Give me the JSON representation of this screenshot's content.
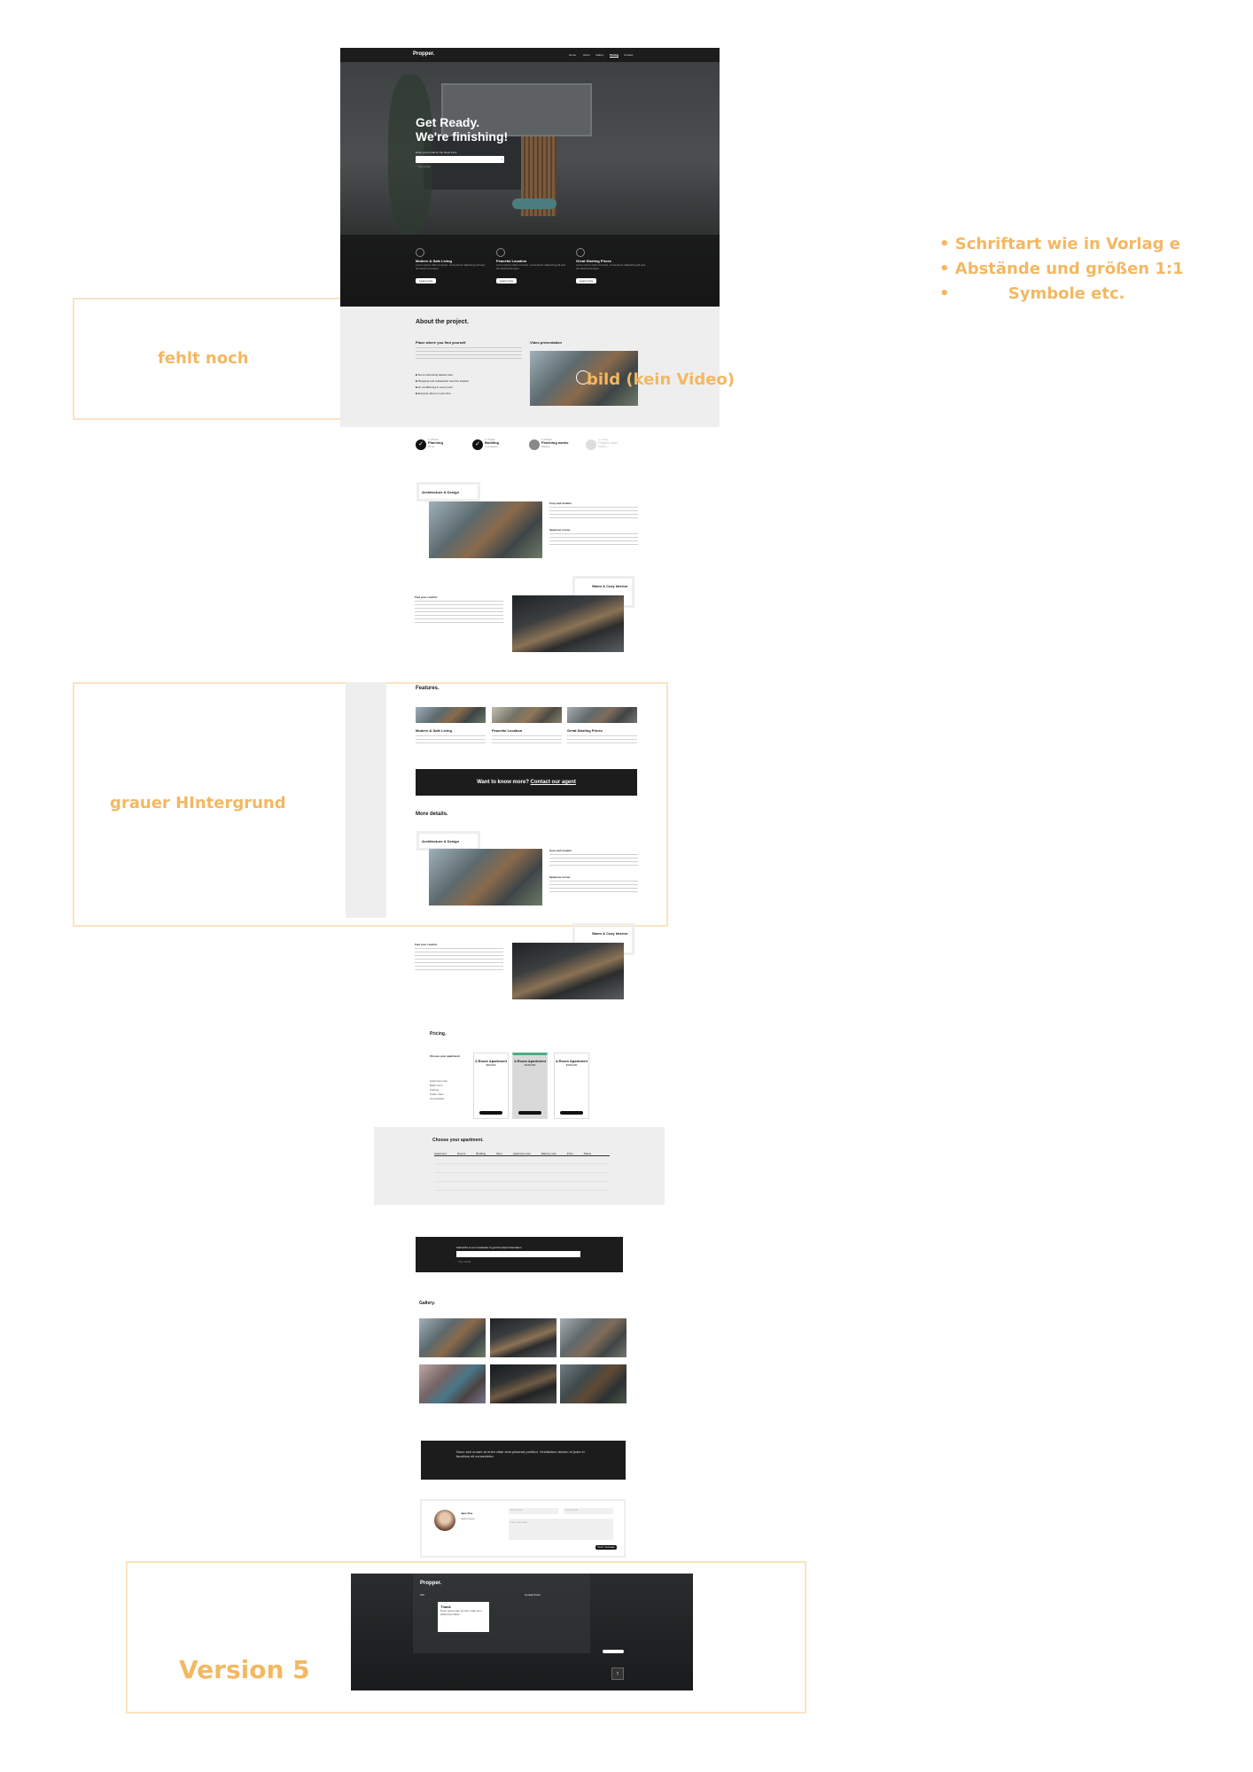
{
  "annotations": {
    "bullets": [
      "Schriftart wie in Vorlag e",
      "Abstände und größen 1:1",
      "Symbole etc."
    ],
    "missing": "fehlt noch",
    "image_note": "bild (kein Video)",
    "grey_bg": "grauer HIntergrund",
    "version": "Version 5"
  },
  "nav": {
    "logo": "Propper.",
    "items": [
      "Home",
      "About",
      "Gallery",
      "Pricing",
      "Contact"
    ],
    "active": "Pricing"
  },
  "hero": {
    "title_line1": "Get Ready.",
    "title_line2": "We're finishing!",
    "signup_label": "Enter your email for the latest infos",
    "email_placeholder": "Your email"
  },
  "hero_features": [
    {
      "title": "Modern & Safe Living",
      "text": "Lorem ipsum dolor sit amet, consectetur adipiscing elit sed do eiusmod tempor.",
      "button": "Learn more"
    },
    {
      "title": "Peaceful Location",
      "text": "Lorem ipsum dolor sit amet, consectetur adipiscing elit sed do eiusmod tempor.",
      "button": "Learn more"
    },
    {
      "title": "Great Starting Prices",
      "text": "Lorem ipsum dolor sit amet, consectetur adipiscing elit sed do eiusmod tempor.",
      "button": "Learn more"
    }
  ],
  "about": {
    "title": "About the project.",
    "subtitle": "Place where you find yourself",
    "video_label": "Video presentation",
    "checklist": [
      "Some interesting feature here",
      "Shopping and restaurants near the location",
      "Air conditioning in every room",
      "Enjoying nature in your time"
    ]
  },
  "progress": [
    {
      "step": "1. Phase",
      "name": "Planning",
      "status": "Done"
    },
    {
      "step": "2. Phase",
      "name": "Building",
      "status": "In progress"
    },
    {
      "step": "3. Phase",
      "name": "Finishing works",
      "status": "Waiting"
    },
    {
      "step": "4. Phase",
      "name": "Project done",
      "status": "Waiting"
    }
  ],
  "details_a": {
    "tag": "Architecture & Design",
    "h1": "Cozy and modern",
    "h2": "Spacious rooms"
  },
  "details_b": {
    "tag": "Warm & Cozy Interior",
    "h1": "Feel your comfort"
  },
  "features": {
    "title": "Features.",
    "items": [
      {
        "title": "Modern & Safe Living"
      },
      {
        "title": "Peaceful Location"
      },
      {
        "title": "Great Starting Prices"
      }
    ]
  },
  "cta": {
    "text": "Want to know more?",
    "link": "Contact our agent"
  },
  "more_details": {
    "title": "More details."
  },
  "pricing": {
    "title": "Pricing.",
    "choose": "Choose your apartment",
    "rows": [
      "Apartment size",
      "Bathrooms",
      "Parking",
      "Public trans.",
      "Accessibility"
    ],
    "cards": [
      {
        "name": "2-Room Apartment",
        "price": "$99,000"
      },
      {
        "name": "3-Room Apartment",
        "price": "$149,000"
      },
      {
        "name": "4-Room Apartment",
        "price": "$199,000"
      }
    ]
  },
  "table": {
    "title": "Choose your apartment.",
    "headers": [
      "Apartment",
      "Rooms",
      "Building",
      "Floor",
      "Apartment size",
      "Balcony size",
      "Price",
      "Status"
    ]
  },
  "newsletter": {
    "text": "Subscribe to our newsletter to get the latest information",
    "placeholder": "Your email"
  },
  "gallery": {
    "title": "Gallery."
  },
  "quote": {
    "text": "Nunc sed ornare at enim vitae sem placerat porttitor. Vestibulum dictum et justo in faucibus sit consectetur."
  },
  "contact": {
    "name": "Jane Doe",
    "role": "Sales Agent",
    "first_name": "First name",
    "last_name": "Last name",
    "message": "Your message",
    "send": "Send message"
  },
  "footer": {
    "logo": "Propper.",
    "col1": "Info",
    "col2": "Contact Form",
    "popup_title": "Thank",
    "popup_text": "Nunc sed ornare at enim vitae sem placerat porttitor."
  }
}
